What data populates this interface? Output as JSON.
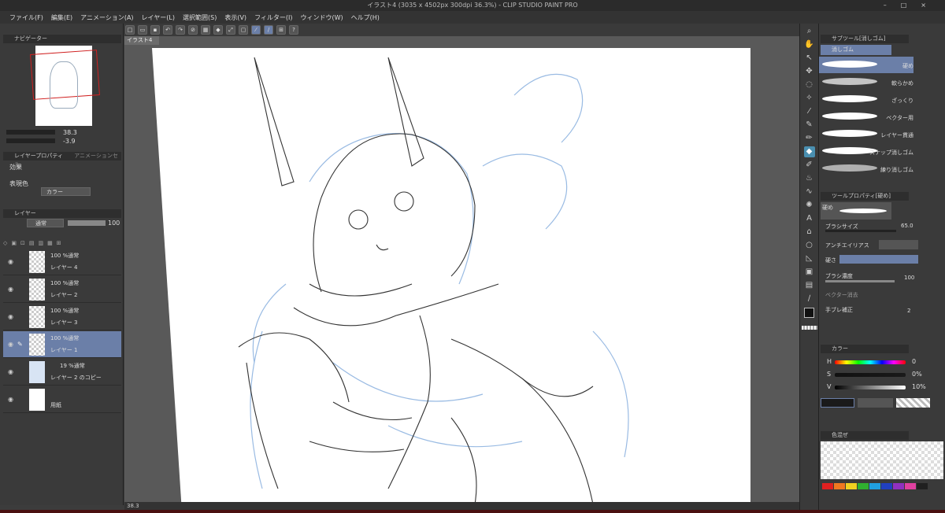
{
  "window": {
    "title": "イラスト4 (3035 x 4502px 300dpi 36.3%) - CLIP STUDIO PAINT PRO"
  },
  "menu": [
    "ファイル(F)",
    "編集(E)",
    "アニメーション(A)",
    "レイヤー(L)",
    "選択範囲(S)",
    "表示(V)",
    "フィルター(I)",
    "ウィンドウ(W)",
    "ヘルプ(H)"
  ],
  "panels": {
    "navigator": "ナビゲーター",
    "layer_property": "レイヤープロパティ",
    "animation_cel": "アニメーションセル",
    "effect_label": "効果",
    "color_expr_label": "表現色",
    "color_expr_value": "カラー",
    "layer": "レイヤー",
    "blend_mode": "通常",
    "opacity": "100",
    "sub_tool": "サブツール[消しゴム]",
    "sub_tool_tab": "消しゴム",
    "tool_property": "ツールプロパティ[硬め]",
    "tool_property_name": "硬め",
    "color_tab": "カラー",
    "palette_tab": "色混ぜ"
  },
  "document_tab": "イラスト4",
  "navigator_zoom": "38.3",
  "navigator_angle": "-3.9",
  "layers": [
    {
      "mode": "100 %通常",
      "name": "レイヤー 4",
      "selected": false
    },
    {
      "mode": "100 %通常",
      "name": "レイヤー 2",
      "selected": false
    },
    {
      "mode": "100 %通常",
      "name": "レイヤー 3",
      "selected": false
    },
    {
      "mode": "100 %通常",
      "name": "レイヤー 1",
      "selected": true
    },
    {
      "mode": "19 %通常",
      "name": "レイヤー 2 のコピー",
      "selected": false
    },
    {
      "mode": "",
      "name": "用紙",
      "selected": false
    }
  ],
  "sub_tools": [
    "硬め",
    "軟らかめ",
    "ざっくり",
    "ベクター用",
    "レイヤー貫通",
    "スナップ消しゴム",
    "練り消しゴム"
  ],
  "tool_props": {
    "brush_size_label": "ブラシサイズ",
    "brush_size_value": "65.0",
    "antialias_label": "アンチエイリアス",
    "hardness_label": "硬さ",
    "density_label": "ブラシ濃度",
    "density_value": "100",
    "vector_erase_label": "ベクター消去",
    "stabilize_label": "手ブレ補正",
    "stabilize_value": "2"
  },
  "color": {
    "h_label": "H",
    "h_value": "0",
    "s_label": "S",
    "s_value": "0%",
    "v_label": "V",
    "v_value": "10%",
    "main": "#1a1a1a",
    "sub": "#555555"
  },
  "palette_colors": [
    "#e02020",
    "#f07820",
    "#f0d020",
    "#30b030",
    "#20a0e0",
    "#2040c0",
    "#9030c0",
    "#e040a0",
    "#202020"
  ],
  "status": {
    "zoom": "38.3"
  },
  "colors": {
    "accent": "#6b7fa8",
    "tool_selected": "#4a8fb0",
    "sketch_blue": "#8fb4e0"
  }
}
